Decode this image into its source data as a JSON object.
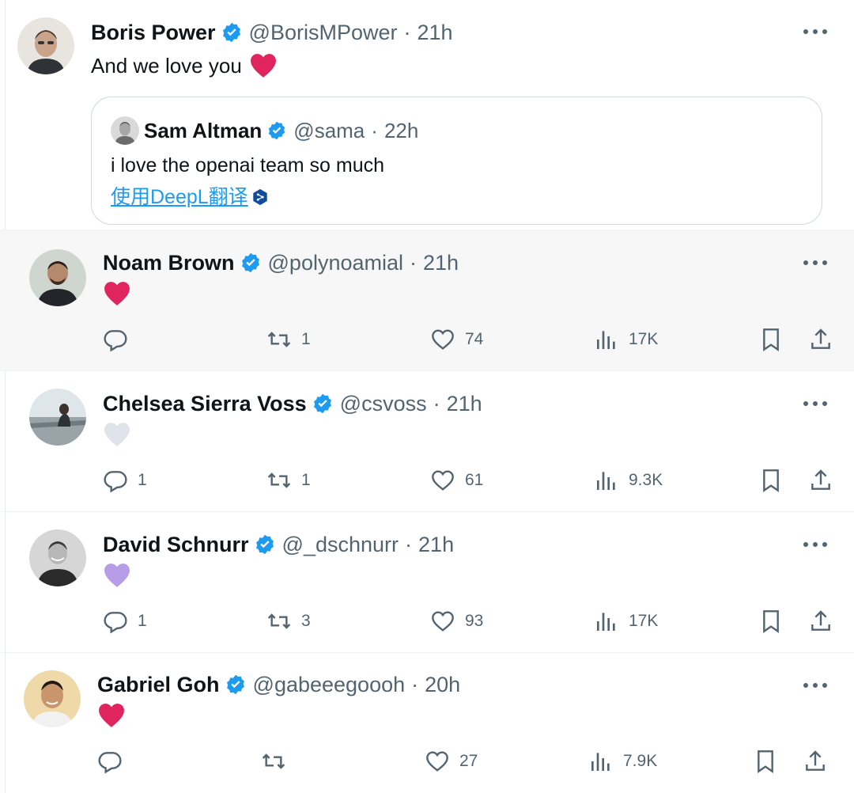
{
  "main_post": {
    "author_name": "Boris Power",
    "handle": "@BorisMPower",
    "separator": "·",
    "time": "21h",
    "text": "And we love you",
    "text_emoji": "red-heart",
    "quoted": {
      "author_name": "Sam Altman",
      "handle": "@sama",
      "separator": "·",
      "time": "22h",
      "text": "i love the openai team so much",
      "translate_link": "使用DeepL翻译"
    }
  },
  "replies": [
    {
      "author_name": "Noam Brown",
      "handle": "@polynoamial",
      "separator": "·",
      "time": "21h",
      "emoji": "red-heart",
      "replies_count": "",
      "reposts_count": "1",
      "likes_count": "74",
      "views_count": "17K"
    },
    {
      "author_name": "Chelsea Sierra Voss",
      "handle": "@csvoss",
      "separator": "·",
      "time": "21h",
      "emoji": "white-heart",
      "replies_count": "1",
      "reposts_count": "1",
      "likes_count": "61",
      "views_count": "9.3K"
    },
    {
      "author_name": "David Schnurr",
      "handle": "@_dschnurr",
      "separator": "·",
      "time": "21h",
      "emoji": "purple-heart",
      "replies_count": "1",
      "reposts_count": "3",
      "likes_count": "93",
      "views_count": "17K"
    },
    {
      "author_name": "Gabriel Goh",
      "handle": "@gabeeegoooh",
      "separator": "·",
      "time": "20h",
      "emoji": "red-heart",
      "replies_count": "",
      "reposts_count": "",
      "likes_count": "27",
      "views_count": "7.9K"
    }
  ],
  "icons": {
    "verified_badge": "verified-badge-icon",
    "more": "more-icon",
    "reply": "reply-icon",
    "repost": "repost-icon",
    "like": "like-icon",
    "views": "views-icon",
    "bookmark": "bookmark-icon",
    "share": "share-icon"
  },
  "colors": {
    "verified": "#1d9bf0",
    "link": "#1d9bf0",
    "text_primary": "#0f1419",
    "text_secondary": "#536471",
    "red_heart": "#e0245e",
    "white_heart": "#dfe4ea",
    "purple_heart": "#b79ce8"
  }
}
